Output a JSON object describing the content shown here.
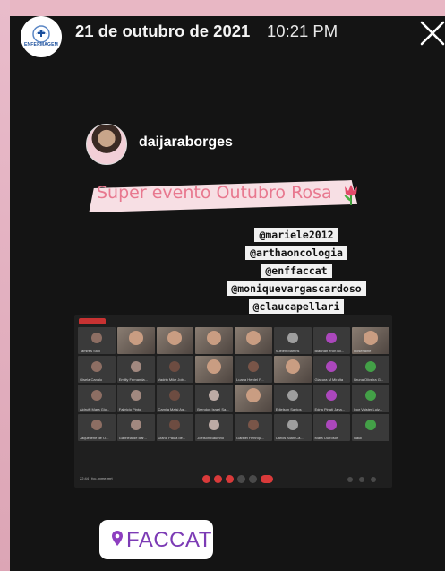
{
  "header": {
    "account_logo_text": "ENFERMAGEM",
    "date": "21 de outubro de 2021",
    "time": "10:21 PM"
  },
  "post": {
    "username": "daijaraborges",
    "banner_text": "Super evento Outubro Rosa",
    "mentions": [
      "@mariele2012",
      "@arthaoncologia",
      "@enffaccat",
      "@moniquevargascardoso",
      "@claucapellari"
    ]
  },
  "video_call": {
    "participants": [
      {
        "name": "Tamires Stoll",
        "video": false
      },
      {
        "name": "",
        "video": true
      },
      {
        "name": "",
        "video": true
      },
      {
        "name": "",
        "video": true
      },
      {
        "name": "",
        "video": true
      },
      {
        "name": "Suelen Martins",
        "video": false
      },
      {
        "name": "Bianhan eron ho...",
        "video": false
      },
      {
        "name": "Roserlaine",
        "video": true
      },
      {
        "name": "Gisela Canalo",
        "video": false
      },
      {
        "name": "Emilly Fernanda...",
        "video": false
      },
      {
        "name": "Vadriu Mike Job...",
        "video": false
      },
      {
        "name": "",
        "video": true
      },
      {
        "name": "Luana Herdel P...",
        "video": false
      },
      {
        "name": "",
        "video": true
      },
      {
        "name": "Giacura M Miralta",
        "video": false
      },
      {
        "name": "Bruna Oliveira G...",
        "video": false
      },
      {
        "name": "Aidruffi Mara Gio...",
        "video": false
      },
      {
        "name": "Fabricio Pinto",
        "video": false
      },
      {
        "name": "Camila Maisi Ag...",
        "video": false
      },
      {
        "name": "Brendon Israel Sa...",
        "video": false
      },
      {
        "name": "",
        "video": true
      },
      {
        "name": "Edielson Santos",
        "video": false
      },
      {
        "name": "Edna Pinati Jana...",
        "video": false
      },
      {
        "name": "Igor Vaister Luiz...",
        "video": false
      },
      {
        "name": "Jaqueliene de O...",
        "video": false
      },
      {
        "name": "Gabriela de Bar...",
        "video": false
      },
      {
        "name": "Diana Paula de...",
        "video": false
      },
      {
        "name": "Joelson Baumho",
        "video": false
      },
      {
        "name": "Gabriel Henriqu...",
        "video": false
      },
      {
        "name": "Carlos Allan Ca...",
        "video": false
      },
      {
        "name": "Mara Outrosos",
        "video": false
      },
      {
        "name": "Bauli",
        "video": false
      }
    ],
    "info_text": "22:44 | fcc-hxme-mrt"
  },
  "location_sticker": {
    "label": "FACCAT"
  },
  "colors": {
    "story_bg": "#141414",
    "banner_text": "#e8788f",
    "faccat_purple": "#7c3bb5",
    "end_call_red": "#d93a3a"
  }
}
